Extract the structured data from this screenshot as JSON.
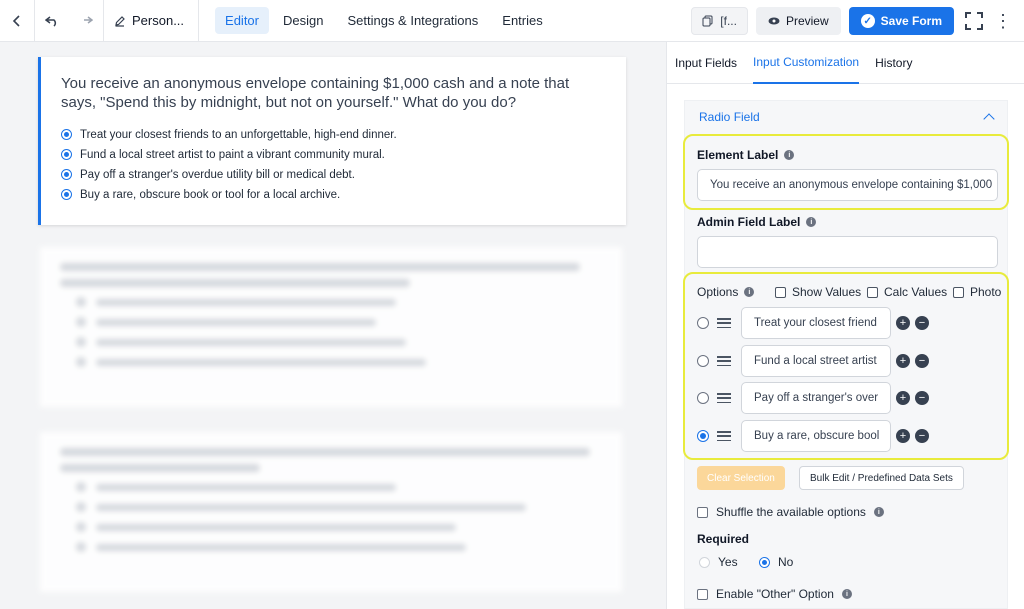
{
  "topbar": {
    "form_title": "Person...",
    "nav": [
      "Editor",
      "Design",
      "Settings & Integrations",
      "Entries"
    ],
    "active_nav": "Editor",
    "shortcode_label": "[f...",
    "preview_label": "Preview",
    "save_label": "Save Form"
  },
  "question": {
    "title": "You receive an anonymous envelope containing $1,000 cash and a note that says, \"Spend this by midnight, but not on yourself.\" What do you do?",
    "options": [
      "Treat your closest friends to an unforgettable, high-end dinner.",
      "Fund a local street artist to paint a vibrant community mural.",
      "Pay off a stranger's overdue utility bill or medical debt.",
      "Buy a rare, obscure book or tool for a local archive."
    ]
  },
  "sidebar": {
    "tabs": [
      "Input Fields",
      "Input Customization",
      "History"
    ],
    "active_tab": "Input Customization",
    "section_title": "Radio Field",
    "element_label": "Element Label",
    "element_label_value": "You receive an anonymous envelope containing $1,000",
    "admin_label": "Admin Field Label",
    "admin_label_value": "",
    "options_label": "Options",
    "show_values": "Show Values",
    "calc_values": "Calc Values",
    "photo": "Photo",
    "option_values": [
      "Treat your closest friend",
      "Fund a local street artist",
      "Pay off a stranger's over",
      "Buy a rare, obscure bool"
    ],
    "selected_option_index": 3,
    "clear_selection": "Clear Selection",
    "bulk_edit": "Bulk Edit / Predefined Data Sets",
    "shuffle": "Shuffle the available options",
    "required": "Required",
    "yes": "Yes",
    "no": "No",
    "required_value": "No",
    "enable_other": "Enable \"Other\" Option"
  },
  "colors": {
    "accent": "#1a73e8",
    "highlight": "#e8eb3c"
  }
}
